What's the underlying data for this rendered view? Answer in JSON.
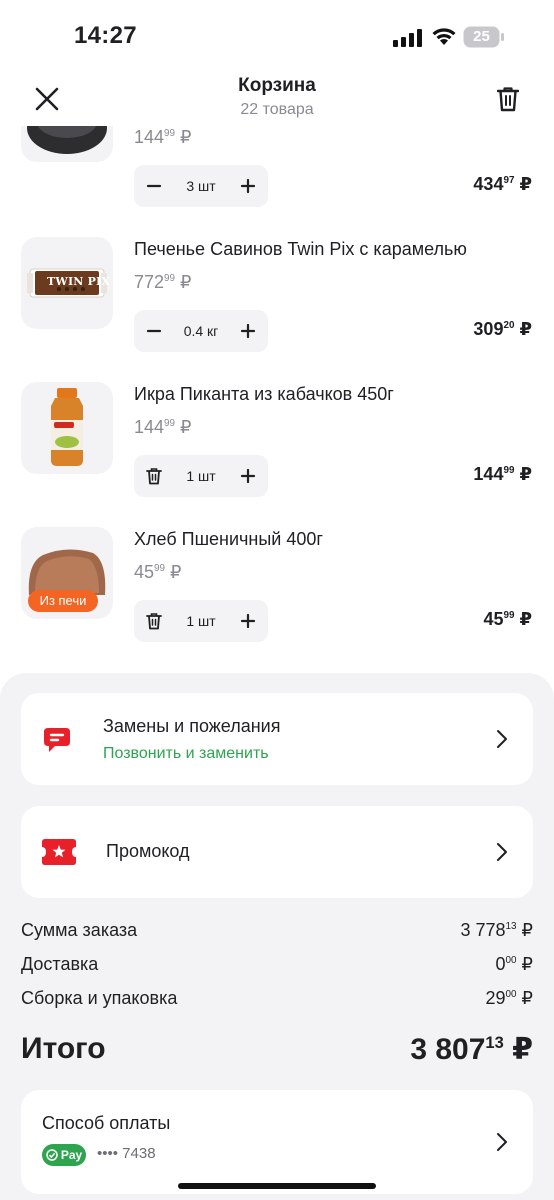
{
  "status_bar": {
    "time": "14:27",
    "battery": "25"
  },
  "header": {
    "title": "Корзина",
    "subtitle": "22 товара"
  },
  "items": [
    {
      "name": "",
      "price_int": "144",
      "price_dec": "99",
      "currency": "₽",
      "qty": "3 шт",
      "total_int": "434",
      "total_dec": "97",
      "first_control": "minus"
    },
    {
      "name": "Печенье Савинов Twin Pix с карамелью",
      "price_int": "772",
      "price_dec": "99",
      "currency": "₽",
      "qty": "0.4 кг",
      "total_int": "309",
      "total_dec": "20",
      "first_control": "minus",
      "pack_text": "TWIN PIX"
    },
    {
      "name": "Икра Пиканта из кабачков 450г",
      "price_int": "144",
      "price_dec": "99",
      "currency": "₽",
      "qty": "1 шт",
      "total_int": "144",
      "total_dec": "99",
      "first_control": "delete"
    },
    {
      "name": "Хлеб Пшеничный 400г",
      "price_int": "45",
      "price_dec": "99",
      "currency": "₽",
      "qty": "1 шт",
      "total_int": "45",
      "total_dec": "99",
      "first_control": "delete",
      "badge": "Из печи"
    }
  ],
  "replacements": {
    "title": "Замены и пожелания",
    "link": "Позвонить и заменить"
  },
  "promo": {
    "title": "Промокод"
  },
  "summary": {
    "rows": [
      {
        "label": "Сумма заказа",
        "int": "3 778",
        "dec": "13",
        "currency": "₽"
      },
      {
        "label": "Доставка",
        "int": "0",
        "dec": "00",
        "currency": "₽"
      },
      {
        "label": "Сборка и упаковка",
        "int": "29",
        "dec": "00",
        "currency": "₽"
      }
    ],
    "total_label": "Итого",
    "total_int": "3 807",
    "total_dec": "13",
    "total_currency": "₽"
  },
  "payment": {
    "title": "Способ оплаты",
    "badge": "Pay",
    "card": "•••• 7438"
  },
  "colors": {
    "accent_red": "#e8202a",
    "accent_green": "#2ea44f",
    "oven_orange": "#f26522",
    "sheet_bg": "#f3f3f5"
  }
}
